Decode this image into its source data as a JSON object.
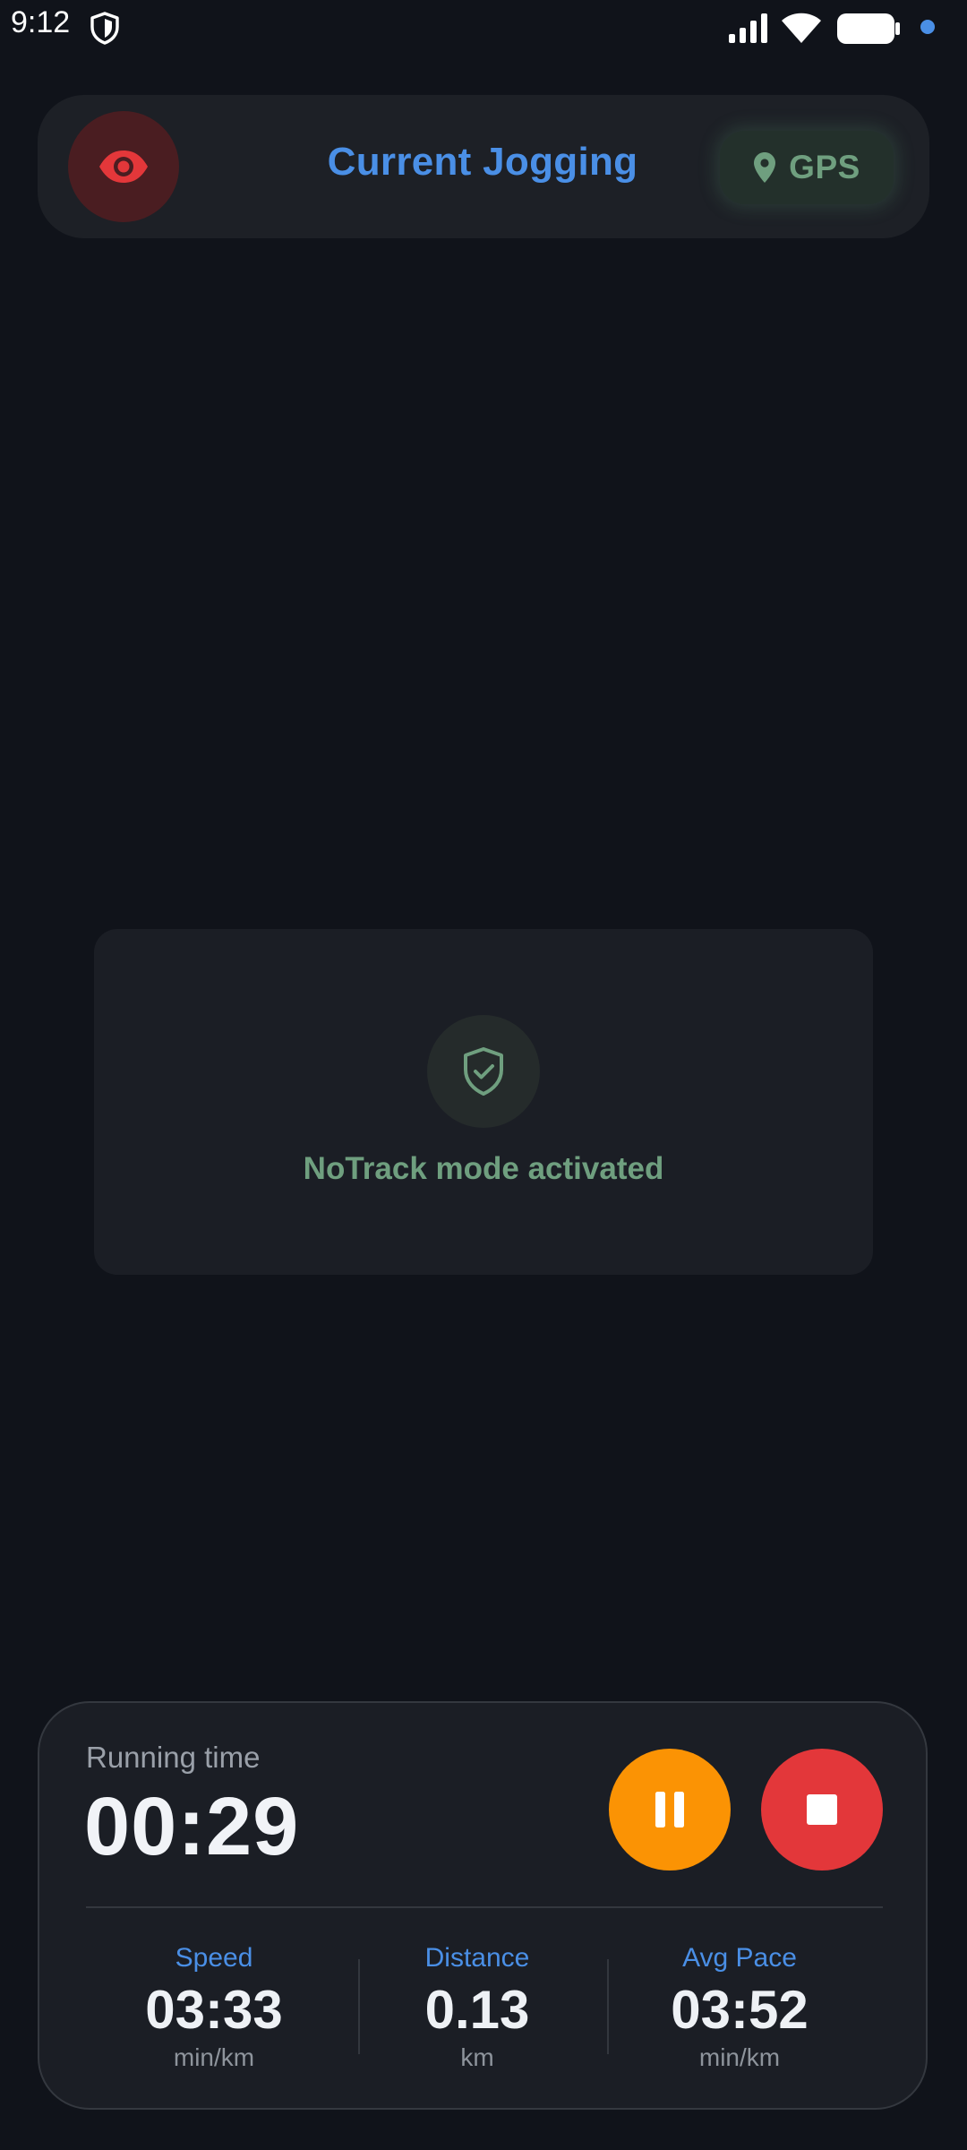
{
  "status_bar": {
    "time": "9:12",
    "icons": [
      "shield-icon",
      "signal-icon",
      "wifi-icon",
      "battery-icon",
      "notification-dot"
    ]
  },
  "header": {
    "title": "Current Jogging",
    "visibility_icon": "eye-icon",
    "gps": {
      "label": "GPS",
      "icon": "location-pin-icon"
    }
  },
  "notrack": {
    "icon": "shield-check-icon",
    "message": "NoTrack mode activated"
  },
  "session": {
    "running_time_label": "Running time",
    "running_time": "00:29",
    "pause_icon": "pause-icon",
    "stop_icon": "stop-icon",
    "stats": [
      {
        "label": "Speed",
        "value": "03:33",
        "unit": "min/km"
      },
      {
        "label": "Distance",
        "value": "0.13",
        "unit": "km"
      },
      {
        "label": "Avg Pace",
        "value": "03:52",
        "unit": "min/km"
      }
    ]
  },
  "colors": {
    "background": "#10131a",
    "accent_blue": "#4a8fe6",
    "notrack_green": "#6f9f7f",
    "pause_orange": "#fb9304",
    "stop_red": "#e3373a",
    "eye_red": "#e3373a"
  }
}
